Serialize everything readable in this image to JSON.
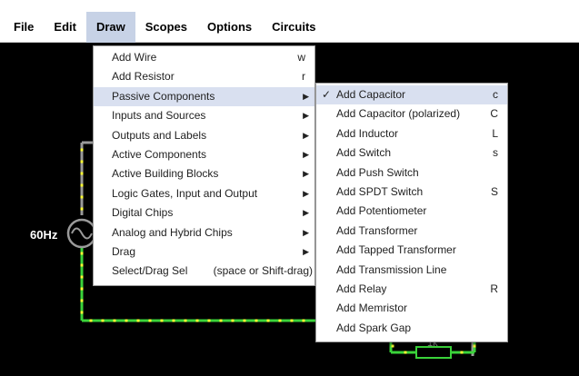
{
  "menubar": {
    "items": [
      "File",
      "Edit",
      "Draw",
      "Scopes",
      "Options",
      "Circuits"
    ],
    "active_index": 2
  },
  "draw_menu": {
    "items": [
      {
        "label": "Add Wire",
        "shortcut": "w"
      },
      {
        "label": "Add Resistor",
        "shortcut": "r"
      },
      {
        "label": "Passive Components",
        "submenu": true
      },
      {
        "label": "Inputs and Sources",
        "submenu": true
      },
      {
        "label": "Outputs and Labels",
        "submenu": true
      },
      {
        "label": "Active Components",
        "submenu": true
      },
      {
        "label": "Active Building Blocks",
        "submenu": true
      },
      {
        "label": "Logic Gates, Input and Output",
        "submenu": true
      },
      {
        "label": "Digital Chips",
        "submenu": true
      },
      {
        "label": "Analog and Hybrid Chips",
        "submenu": true
      },
      {
        "label": "Drag",
        "submenu": true
      },
      {
        "label": "Select/Drag Sel",
        "shortcut": "(space or Shift-drag)"
      }
    ],
    "highlighted_index": 2
  },
  "passive_menu": {
    "items": [
      {
        "label": "Add Capacitor",
        "shortcut": "c",
        "checked": true
      },
      {
        "label": "Add Capacitor (polarized)",
        "shortcut": "C"
      },
      {
        "label": "Add Inductor",
        "shortcut": "L"
      },
      {
        "label": "Add Switch",
        "shortcut": "s"
      },
      {
        "label": "Add Push Switch",
        "shortcut": ""
      },
      {
        "label": "Add SPDT Switch",
        "shortcut": "S"
      },
      {
        "label": "Add Potentiometer",
        "shortcut": ""
      },
      {
        "label": "Add Transformer",
        "shortcut": ""
      },
      {
        "label": "Add Tapped Transformer",
        "shortcut": ""
      },
      {
        "label": "Add Transmission Line",
        "shortcut": ""
      },
      {
        "label": "Add Relay",
        "shortcut": "R"
      },
      {
        "label": "Add Memristor",
        "shortcut": ""
      },
      {
        "label": "Add Spark Gap",
        "shortcut": ""
      }
    ],
    "check_glyph": "✓",
    "submenu_arrow": "▶"
  },
  "circuit": {
    "source_label": "60Hz",
    "resistor_label": "1k",
    "wire_color": "#3ad33a",
    "dot_color": "#ffff33",
    "gray_wire_color": "#9a9a9a"
  }
}
